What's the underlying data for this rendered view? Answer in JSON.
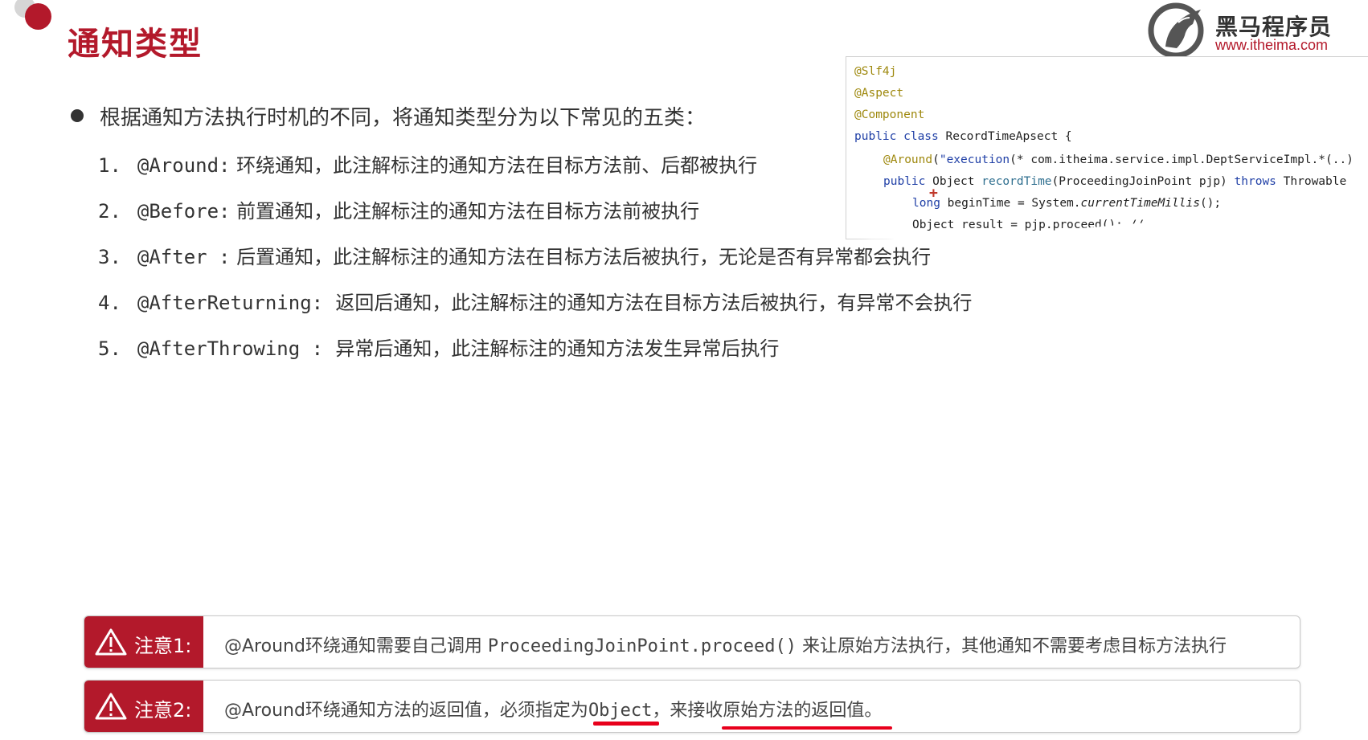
{
  "title": "通知类型",
  "logo": {
    "name": "黑马程序员",
    "url": "www.itheima.com",
    "emblem": "horse-head-icon"
  },
  "intro": "根据通知方法执行时机的不同，将通知类型分为以下常见的五类：",
  "types": [
    {
      "num": "1.",
      "name": "@Around:",
      "desc": "环绕通知，此注解标注的通知方法在目标方法前、后都被执行"
    },
    {
      "num": "2.",
      "name": "@Before:",
      "desc": "前置通知，此注解标注的通知方法在目标方法前被执行"
    },
    {
      "num": "3.",
      "name": "@After :",
      "desc": "后置通知，此注解标注的通知方法在目标方法后被执行，无论是否有异常都会执行"
    },
    {
      "num": "4.",
      "name": "@AfterReturning:",
      "desc": "返回后通知，此注解标注的通知方法在目标方法后被执行，有异常不会执行"
    },
    {
      "num": "5.",
      "name": "@AfterThrowing :",
      "desc": "异常后通知，此注解标注的通知方法发生异常后执行"
    }
  ],
  "code": {
    "line1": "@Slf4j",
    "line2": "@Aspect",
    "line3": "@Component",
    "line4_kw": "public class",
    "line4_rest": " RecordTimeApsect {",
    "line5_anno": "@Around",
    "line5_paren": "(",
    "line5_str": "\"execution",
    "line5_rest": "(* com.itheima.service.impl.DeptServiceImpl.*(..)",
    "line6_kw": "public",
    "line6_type": " Object ",
    "line6_method": "recordTime",
    "line6_params": "(ProceedingJoinPoint pjp) ",
    "line6_throws": "throws",
    "line6_end": " Throwable",
    "line7_kw": "long",
    "line7_mid": " beginTime = System.",
    "line7_call": "currentTimeMillis",
    "line7_end": "();",
    "line8": "Object result = pjp.proceed(); //"
  },
  "notes": [
    {
      "label": "注意1:",
      "text_a": "@Around环绕通知需要自己调用 ",
      "code": "ProceedingJoinPoint.proceed()",
      "text_b": " 来让原始方法执行，其他通知不需要考虑目标方法执行"
    },
    {
      "label": "注意2:",
      "text_a": "@Around环绕通知方法的返回值，必须指定为",
      "code": "Object",
      "text_b": "，来接收原始方法的返回值。"
    }
  ],
  "colors": {
    "brand_red": "#b3192b",
    "annotation": "#9e880d",
    "keyword": "#1f3fa6",
    "underline": "#e8001c"
  }
}
